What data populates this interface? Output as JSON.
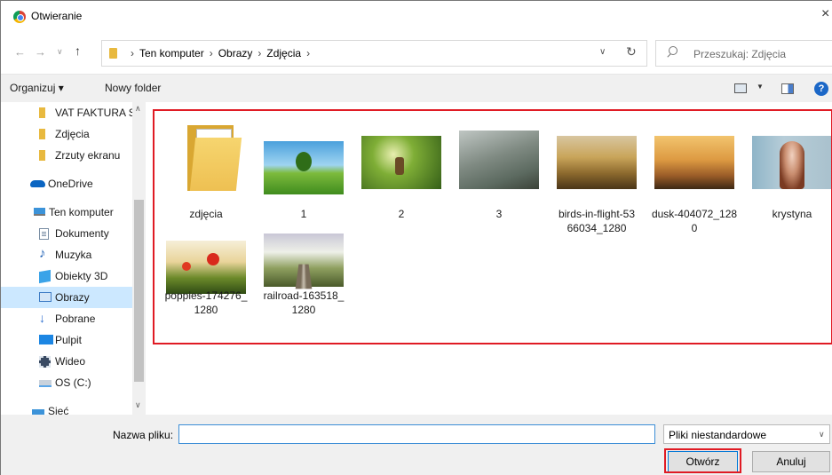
{
  "window": {
    "title": "Otwieranie"
  },
  "nav": {
    "breadcrumbs": [
      "Ten komputer",
      "Obrazy",
      "Zdjęcia"
    ],
    "search_placeholder": "Przeszukaj: Zdjęcia"
  },
  "toolbar": {
    "organize_label": "Organizuj ▾",
    "new_folder_label": "Nowy folder"
  },
  "sidebar": {
    "items": [
      {
        "label": "VAT FAKTURA ST",
        "icon": "folder-icon"
      },
      {
        "label": "Zdjęcia",
        "icon": "folder-icon"
      },
      {
        "label": "Zrzuty ekranu",
        "icon": "folder-icon"
      },
      {
        "label": "OneDrive",
        "icon": "cloud-icon"
      },
      {
        "label": "Ten komputer",
        "icon": "computer-icon"
      },
      {
        "label": "Dokumenty",
        "icon": "documents-icon"
      },
      {
        "label": "Muzyka",
        "icon": "music-icon"
      },
      {
        "label": "Obiekty 3D",
        "icon": "3d-objects-icon"
      },
      {
        "label": "Obrazy",
        "icon": "pictures-icon",
        "selected": true
      },
      {
        "label": "Pobrane",
        "icon": "downloads-icon"
      },
      {
        "label": "Pulpit",
        "icon": "desktop-icon"
      },
      {
        "label": "Wideo",
        "icon": "video-icon"
      },
      {
        "label": "OS (C:)",
        "icon": "drive-icon"
      },
      {
        "label": "Sieć",
        "icon": "network-icon"
      }
    ]
  },
  "files": [
    {
      "name": "zdjęcia",
      "kind": "folder"
    },
    {
      "name": "1",
      "kind": "image"
    },
    {
      "name": "2",
      "kind": "image"
    },
    {
      "name": "3",
      "kind": "image"
    },
    {
      "name": "birds-in-flight-53\n66034_1280",
      "kind": "image"
    },
    {
      "name": "dusk-404072_128\n0",
      "kind": "image"
    },
    {
      "name": "krystyna",
      "kind": "image"
    },
    {
      "name": "poppies-174276_\n1280",
      "kind": "image"
    },
    {
      "name": "railroad-163518_\n1280",
      "kind": "image"
    }
  ],
  "bottom": {
    "filename_label": "Nazwa pliku:",
    "filename_value": "",
    "filetype_value": "Pliki niestandardowe",
    "open_label": "Otwórz",
    "cancel_label": "Anuluj"
  },
  "colors": {
    "highlight": "#e01b24",
    "selection": "#cce8ff",
    "accent": "#0078d7"
  }
}
